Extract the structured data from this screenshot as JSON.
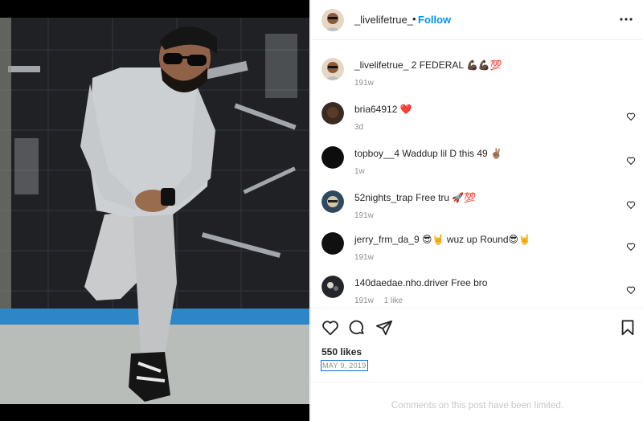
{
  "post": {
    "username": "_livelifetrue_",
    "dot": "•",
    "follow_label": "Follow",
    "more_icon": "more-options-icon"
  },
  "caption": {
    "username": "_livelifetrue_",
    "text": "2 FEDERAL 💪🏿💪🏿💯",
    "time": "191w"
  },
  "comments": [
    {
      "username": "bria64912",
      "text": "❤️",
      "time": "3d",
      "likes": ""
    },
    {
      "username": "topboy__4",
      "text": "Waddup lil D this 49 ✌🏽",
      "time": "1w",
      "likes": ""
    },
    {
      "username": "52nights_trap",
      "text": "Free tru 🚀💯",
      "time": "191w",
      "likes": ""
    },
    {
      "username": "jerry_frm_da_9",
      "text": "😎🤘 wuz up Round😎🤘",
      "time": "191w",
      "likes": ""
    },
    {
      "username": "140daedae.nho.driver",
      "text": "Free bro",
      "time": "191w",
      "likes": "1 like"
    }
  ],
  "actions": {
    "like_icon": "heart-icon",
    "comment_icon": "comment-icon",
    "share_icon": "share-icon",
    "save_icon": "bookmark-icon"
  },
  "likes_text": "550 likes",
  "date_text": "MAY 9, 2019",
  "limited_text": "Comments on this post have been limited.",
  "colors": {
    "accent": "#0095f6",
    "text": "#262626",
    "muted": "#8e8e8e",
    "border": "#efefef"
  }
}
